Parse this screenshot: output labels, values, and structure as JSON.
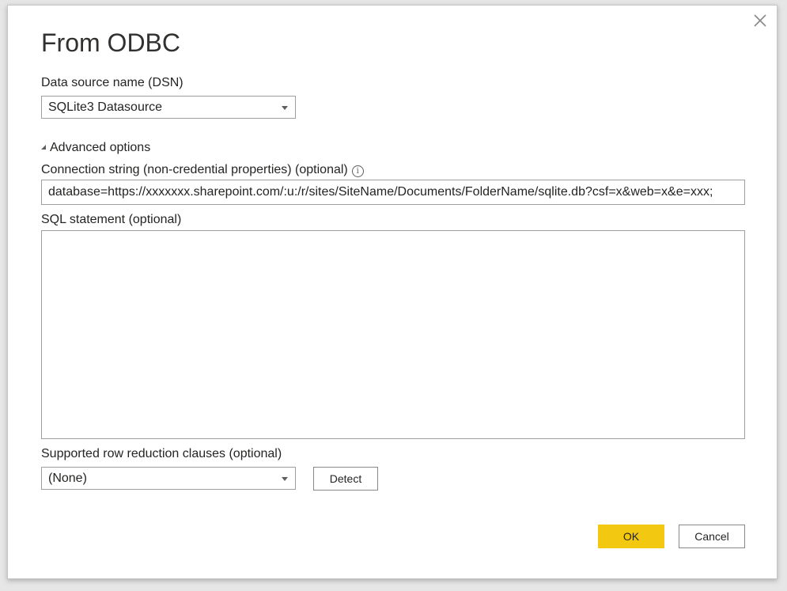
{
  "dialog": {
    "title": "From ODBC",
    "close_icon": "close-icon"
  },
  "dsn": {
    "label": "Data source name (DSN)",
    "selected": "SQLite3 Datasource"
  },
  "advanced": {
    "toggle_label": "Advanced options",
    "expanded": true,
    "connection_string": {
      "label": "Connection string (non-credential properties) (optional)",
      "info_icon": "info-icon",
      "value": "database=https://xxxxxxx.sharepoint.com/:u:/r/sites/SiteName/Documents/FolderName/sqlite.db?csf=x&web=x&e=xxx;"
    },
    "sql_statement": {
      "label": "SQL statement (optional)",
      "value": ""
    },
    "row_reduction": {
      "label": "Supported row reduction clauses (optional)",
      "selected": "(None)",
      "detect_label": "Detect"
    }
  },
  "footer": {
    "ok_label": "OK",
    "cancel_label": "Cancel"
  },
  "colors": {
    "accent": "#f2c811",
    "border": "#a19f9d",
    "background": "#ffffff"
  }
}
